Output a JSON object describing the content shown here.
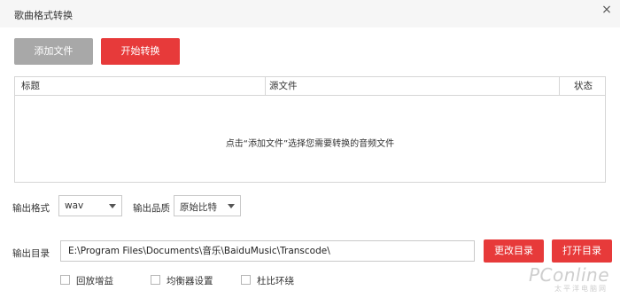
{
  "window": {
    "title": "歌曲格式转换",
    "close_glyph": "×"
  },
  "toolbar": {
    "add_file_label": "添加文件",
    "start_convert_label": "开始转换"
  },
  "file_table": {
    "columns": [
      "标题",
      "源文件",
      "状态"
    ],
    "empty_hint": "点击“添加文件”选择您需要转换的音频文件"
  },
  "output_format": {
    "label": "输出格式",
    "selected": "wav"
  },
  "output_quality": {
    "label": "输出品质",
    "selected": "原始比特"
  },
  "output_dir": {
    "label": "输出目录",
    "value": "E:\\Program  Files\\Documents\\音乐\\BaiduMusic\\Transcode\\",
    "change_label": "更改目录",
    "open_label": "打开目录"
  },
  "options": [
    {
      "label": "回放增益",
      "checked": false
    },
    {
      "label": "均衡器设置",
      "checked": false
    },
    {
      "label": "杜比环绕",
      "checked": false
    }
  ],
  "watermark": {
    "brand": "PConline",
    "tagline": "太平洋电脑网"
  },
  "colors": {
    "accent_red": "#e73a3a",
    "button_gray": "#a8a8a8",
    "border": "#d6d6d6"
  }
}
